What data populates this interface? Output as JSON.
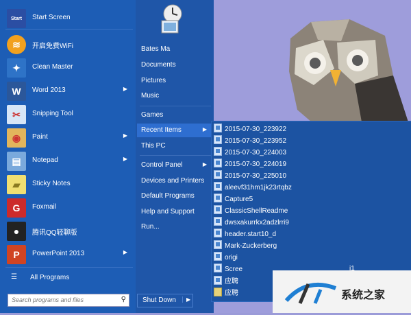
{
  "left_programs": [
    {
      "label": "Start Screen",
      "icon": "start-screen-icon",
      "icon_text": "Start",
      "color": "#2b4ea3",
      "arrow": false
    },
    {
      "label": "开启免费WiFi",
      "icon": "wifi-icon",
      "icon_text": "",
      "color": "#f2a11f",
      "arrow": false
    },
    {
      "label": "Clean Master",
      "icon": "broom-icon",
      "icon_text": "",
      "color": "#2e73c7",
      "arrow": false
    },
    {
      "label": "Word 2013",
      "icon": "word-icon",
      "icon_text": "W",
      "color": "#2b579a",
      "arrow": true
    },
    {
      "label": "Snipping Tool",
      "icon": "scissors-icon",
      "icon_text": "",
      "color": "#d7e6f7",
      "arrow": false
    },
    {
      "label": "Paint",
      "icon": "palette-icon",
      "icon_text": "",
      "color": "#e2b55c",
      "arrow": true
    },
    {
      "label": "Notepad",
      "icon": "notepad-icon",
      "icon_text": "",
      "color": "#7aa9dc",
      "arrow": true
    },
    {
      "label": "Sticky Notes",
      "icon": "sticky-note-icon",
      "icon_text": "",
      "color": "#f0df72",
      "arrow": false
    },
    {
      "label": "Foxmail",
      "icon": "foxmail-icon",
      "icon_text": "G",
      "color": "#cc2b2b",
      "arrow": false
    },
    {
      "label": "腾讯QQ轻聊版",
      "icon": "qq-icon",
      "icon_text": "",
      "color": "#222222",
      "arrow": false
    },
    {
      "label": "PowerPoint 2013",
      "icon": "powerpoint-icon",
      "icon_text": "P",
      "color": "#d04423",
      "arrow": true
    }
  ],
  "all_programs": "All Programs",
  "search_placeholder": "Search programs and files",
  "right_items": {
    "user": "Bates Ma",
    "documents": "Documents",
    "pictures": "Pictures",
    "music": "Music",
    "games": "Games",
    "recent": "Recent Items",
    "thispc": "This PC",
    "control": "Control Panel",
    "devices": "Devices and Printers",
    "default": "Default Programs",
    "help": "Help and Support",
    "run": "Run..."
  },
  "shutdown": "Shut Down",
  "recent_items": [
    "2015-07-30_223922",
    "2015-07-30_223952",
    "2015-07-30_224003",
    "2015-07-30_224019",
    "2015-07-30_225010",
    "aleevf31hm1jk23rtqbz",
    "Capture5",
    "ClassicShellReadme",
    "dwsxakurrkx2adzlrri9",
    "header.start10_d",
    "Mark-Zuckerberg",
    "origi",
    "Scree",
    "应聘",
    "应聘"
  ],
  "recent_item_trailing": "i1",
  "watermark": "系统之家",
  "colors": {
    "menu_left": "#1d5db5",
    "menu_right": "#1f56a8",
    "highlight": "#2e6ed0",
    "wallpaper": "#9e9ddb"
  }
}
